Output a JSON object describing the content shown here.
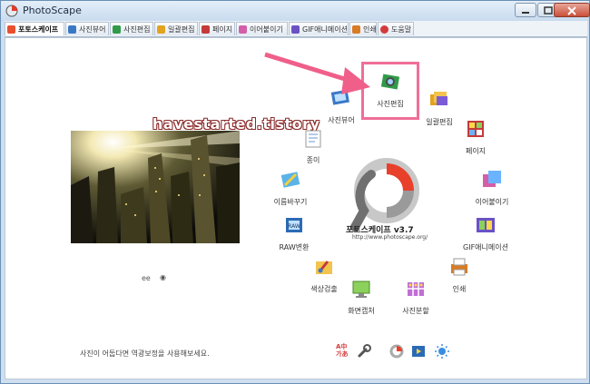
{
  "window": {
    "title": "PhotoScape"
  },
  "tabs": [
    {
      "label": "포토스케이프",
      "color": "#e94f2d"
    },
    {
      "label": "사진뷰어",
      "color": "#3a78c6"
    },
    {
      "label": "사진편집",
      "color": "#2f9b48"
    },
    {
      "label": "일괄편집",
      "color": "#e3a31f"
    },
    {
      "label": "페이지",
      "color": "#c43a3a"
    },
    {
      "label": "이어붙이기",
      "color": "#d45fa8"
    },
    {
      "label": "GIF애니메이션",
      "color": "#6a52c5"
    },
    {
      "label": "인쇄",
      "color": "#d97b23"
    },
    {
      "label": "도움말",
      "color": "#d43b3b"
    }
  ],
  "watermark": "havestarted.tistory",
  "hint": "사진이 어둡다면 역광보정을 사용해보세요.",
  "photo_icons": {
    "left": "ee",
    "right": "◉"
  },
  "logo": {
    "name": "포토스케이프 v3.7",
    "url": "http://www.photoscape.org/"
  },
  "menu": {
    "viewer": "사진뷰어",
    "editor": "사진편집",
    "batch": "일괄편집",
    "paper": "종이",
    "page": "페이지",
    "rename": "이름바꾸기",
    "combine": "이어붙이기",
    "raw": "RAW변환",
    "gif": "GIF애니메이션",
    "color_picker": "색상검출",
    "print": "인쇄",
    "screen_capture": "화면캡처",
    "splitter": "사진분할"
  },
  "toolbar_text": {
    "lang": "A中\n가あ"
  }
}
